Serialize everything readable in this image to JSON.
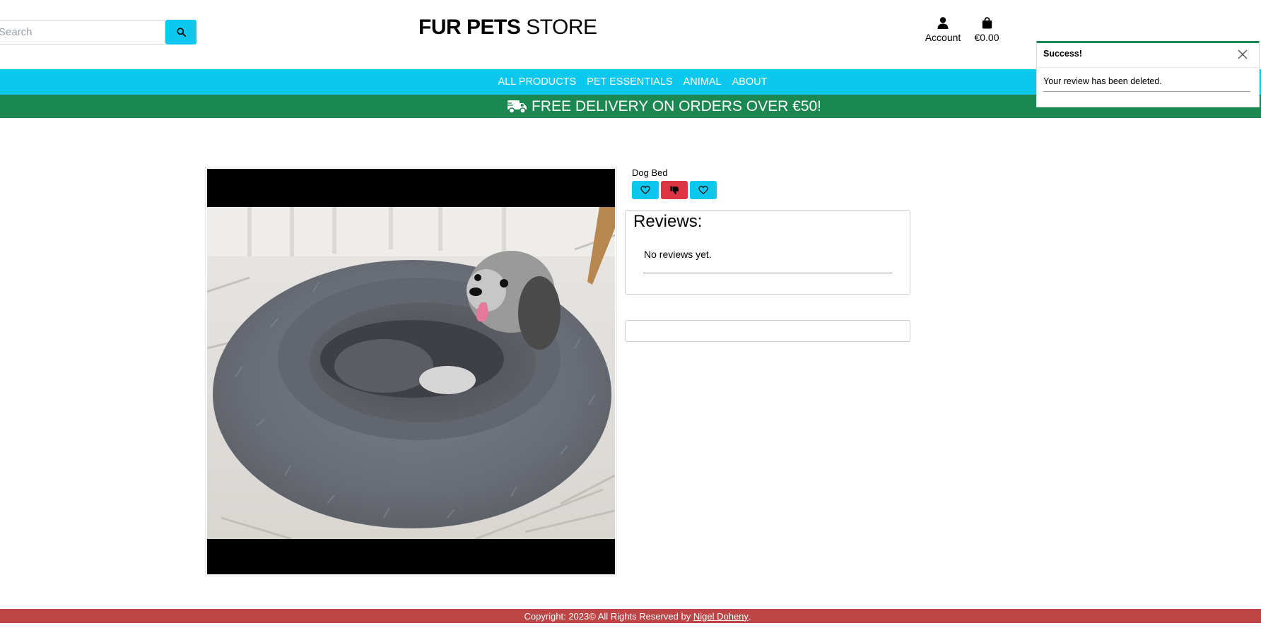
{
  "search": {
    "placeholder": "Search"
  },
  "brand": {
    "bold": "FUR PETS",
    "light": "STORE"
  },
  "header": {
    "account_label": "Account",
    "bag_total": "€0.00"
  },
  "nav": {
    "items": [
      "ALL PRODUCTS",
      "PET ESSENTIALS",
      "ANIMAL",
      "ABOUT"
    ]
  },
  "banner": {
    "text": "FREE DELIVERY ON ORDERS OVER €50!"
  },
  "product": {
    "name": "Dog Bed",
    "image_alt": "Grey dog bed with a small dog"
  },
  "reviews": {
    "title": "Reviews:",
    "empty_text": "No reviews yet."
  },
  "toast": {
    "title": "Success!",
    "message": "Your review has been deleted."
  },
  "footer": {
    "copyright": "Copyright: 2023© All Rights Reserved by",
    "author": "Nigel Doheny",
    "suffix": "."
  },
  "colors": {
    "primary": "#0dc8ee",
    "banner": "#1b8751",
    "danger": "#dc3545",
    "footer": "#bd4545"
  },
  "icons": [
    "search-icon",
    "user-icon",
    "shopping-bag-icon",
    "truck-icon",
    "heart-icon",
    "thumbs-down-icon",
    "close-icon"
  ]
}
